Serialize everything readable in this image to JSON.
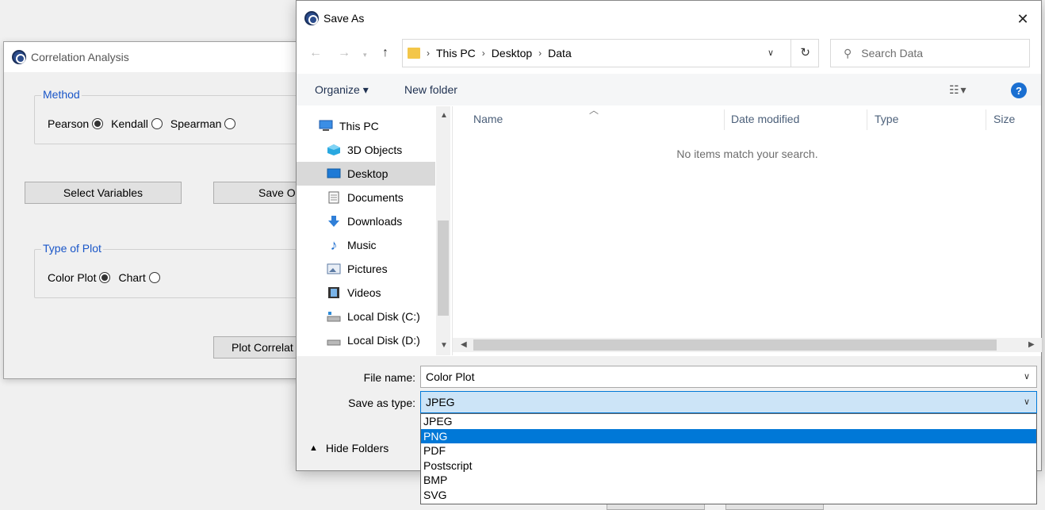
{
  "corr_window": {
    "title": "Correlation Analysis",
    "method_group": {
      "legend": "Method",
      "options": [
        {
          "label": "Pearson",
          "checked": true
        },
        {
          "label": "Kendall",
          "checked": false
        },
        {
          "label": "Spearman",
          "checked": false
        }
      ]
    },
    "select_variables_label": "Select Variables",
    "save_output_label": "Save Ou",
    "plot_group": {
      "legend": "Type of Plot",
      "options": [
        {
          "label": "Color Plot",
          "checked": true
        },
        {
          "label": "Chart",
          "checked": false
        }
      ]
    },
    "plot_button_label": "Plot Correlat"
  },
  "save_dialog": {
    "title": "Save As",
    "close_glyph": "✕",
    "breadcrumb": [
      "This PC",
      "Desktop",
      "Data"
    ],
    "search_placeholder": "Search Data",
    "toolbar": {
      "organize_label": "Organize ▾",
      "new_folder_label": "New folder"
    },
    "nav_items": [
      {
        "label": "This PC",
        "icon": "pc-icon"
      },
      {
        "label": "3D Objects",
        "icon": "cube-icon"
      },
      {
        "label": "Desktop",
        "icon": "desktop-icon",
        "selected": true
      },
      {
        "label": "Documents",
        "icon": "document-icon"
      },
      {
        "label": "Downloads",
        "icon": "download-icon"
      },
      {
        "label": "Music",
        "icon": "music-icon"
      },
      {
        "label": "Pictures",
        "icon": "pictures-icon"
      },
      {
        "label": "Videos",
        "icon": "videos-icon"
      },
      {
        "label": "Local Disk (C:)",
        "icon": "disk-icon"
      },
      {
        "label": "Local Disk (D:)",
        "icon": "disk-icon"
      }
    ],
    "columns": [
      "Name",
      "Date modified",
      "Type",
      "Size"
    ],
    "empty_message": "No items match your search.",
    "file_name_label": "File name:",
    "file_name_value": "Color Plot",
    "save_type_label": "Save as type:",
    "save_type_value": "JPEG",
    "hide_folders_label": "Hide Folders",
    "type_options": [
      "JPEG",
      "PNG",
      "PDF",
      "Postscript",
      "BMP",
      "SVG"
    ],
    "highlighted_option": "PNG"
  }
}
